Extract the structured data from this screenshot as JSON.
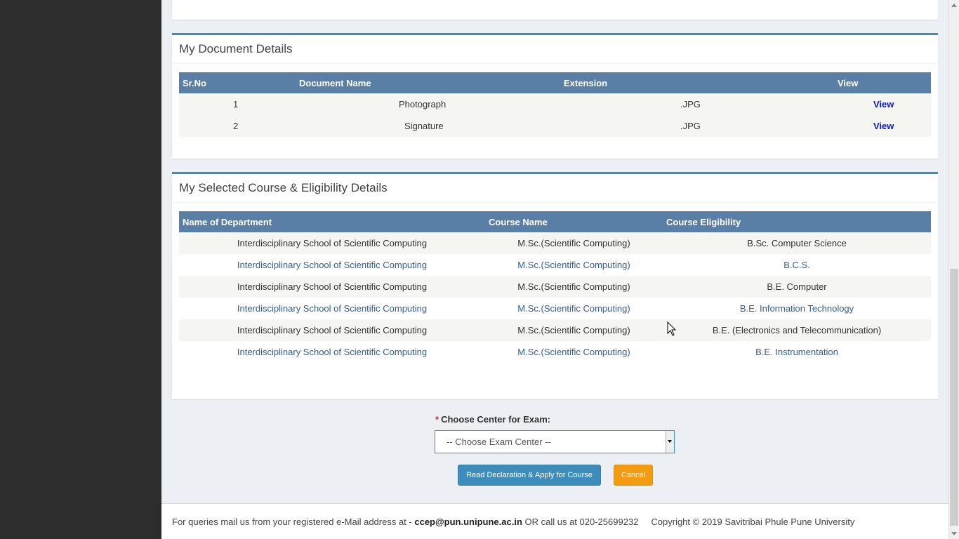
{
  "documents": {
    "title": "My Document Details",
    "columns": [
      "Sr.No",
      "Document Name",
      "Extension",
      "View"
    ],
    "rows": [
      {
        "srno": "1",
        "name": "Photograph",
        "ext": ".JPG",
        "view": "View"
      },
      {
        "srno": "2",
        "name": "Signature",
        "ext": ".JPG",
        "view": "View"
      }
    ]
  },
  "courses": {
    "title": "My Selected Course & Eligibility Details",
    "columns": [
      "Name of Department",
      "Course Name",
      "Course Eligibility"
    ],
    "rows": [
      {
        "dept": "Interdisciplinary School of Scientific Computing",
        "course": "M.Sc.(Scientific Computing)",
        "eligibility": "B.Sc. Computer Science"
      },
      {
        "dept": "Interdisciplinary School of Scientific Computing",
        "course": "M.Sc.(Scientific Computing)",
        "eligibility": "B.C.S."
      },
      {
        "dept": "Interdisciplinary School of Scientific Computing",
        "course": "M.Sc.(Scientific Computing)",
        "eligibility": "B.E. Computer"
      },
      {
        "dept": "Interdisciplinary School of Scientific Computing",
        "course": "M.Sc.(Scientific Computing)",
        "eligibility": "B.E. Information Technology"
      },
      {
        "dept": "Interdisciplinary School of Scientific Computing",
        "course": "M.Sc.(Scientific Computing)",
        "eligibility": "B.E. (Electronics and Telecommunication)"
      },
      {
        "dept": "Interdisciplinary School of Scientific Computing",
        "course": "M.Sc.(Scientific Computing)",
        "eligibility": "B.E. Instrumentation"
      }
    ]
  },
  "exam_center": {
    "required_mark": "*",
    "label": "Choose Center for Exam:",
    "selected": "-- Choose Exam Center --"
  },
  "buttons": {
    "apply": "Read Declaration & Apply for Course",
    "cancel": "Cancel"
  },
  "footer": {
    "prefix": "For queries mail us from your registered e-Mail address at - ",
    "email": "ccep@pun.unipune.ac.in",
    "middle": " OR call us at 020-25699232",
    "copyright": "Copyright ©  2019   Savitribai Phule Pune University"
  },
  "icons": {
    "dropdown": "caret-down-icon",
    "cursor": "mouse-pointer-icon"
  },
  "colors": {
    "accent": "#3c8dbc",
    "table_header": "#5a7fa6",
    "cancel": "#f39c12",
    "link": "#0a1ccf"
  }
}
